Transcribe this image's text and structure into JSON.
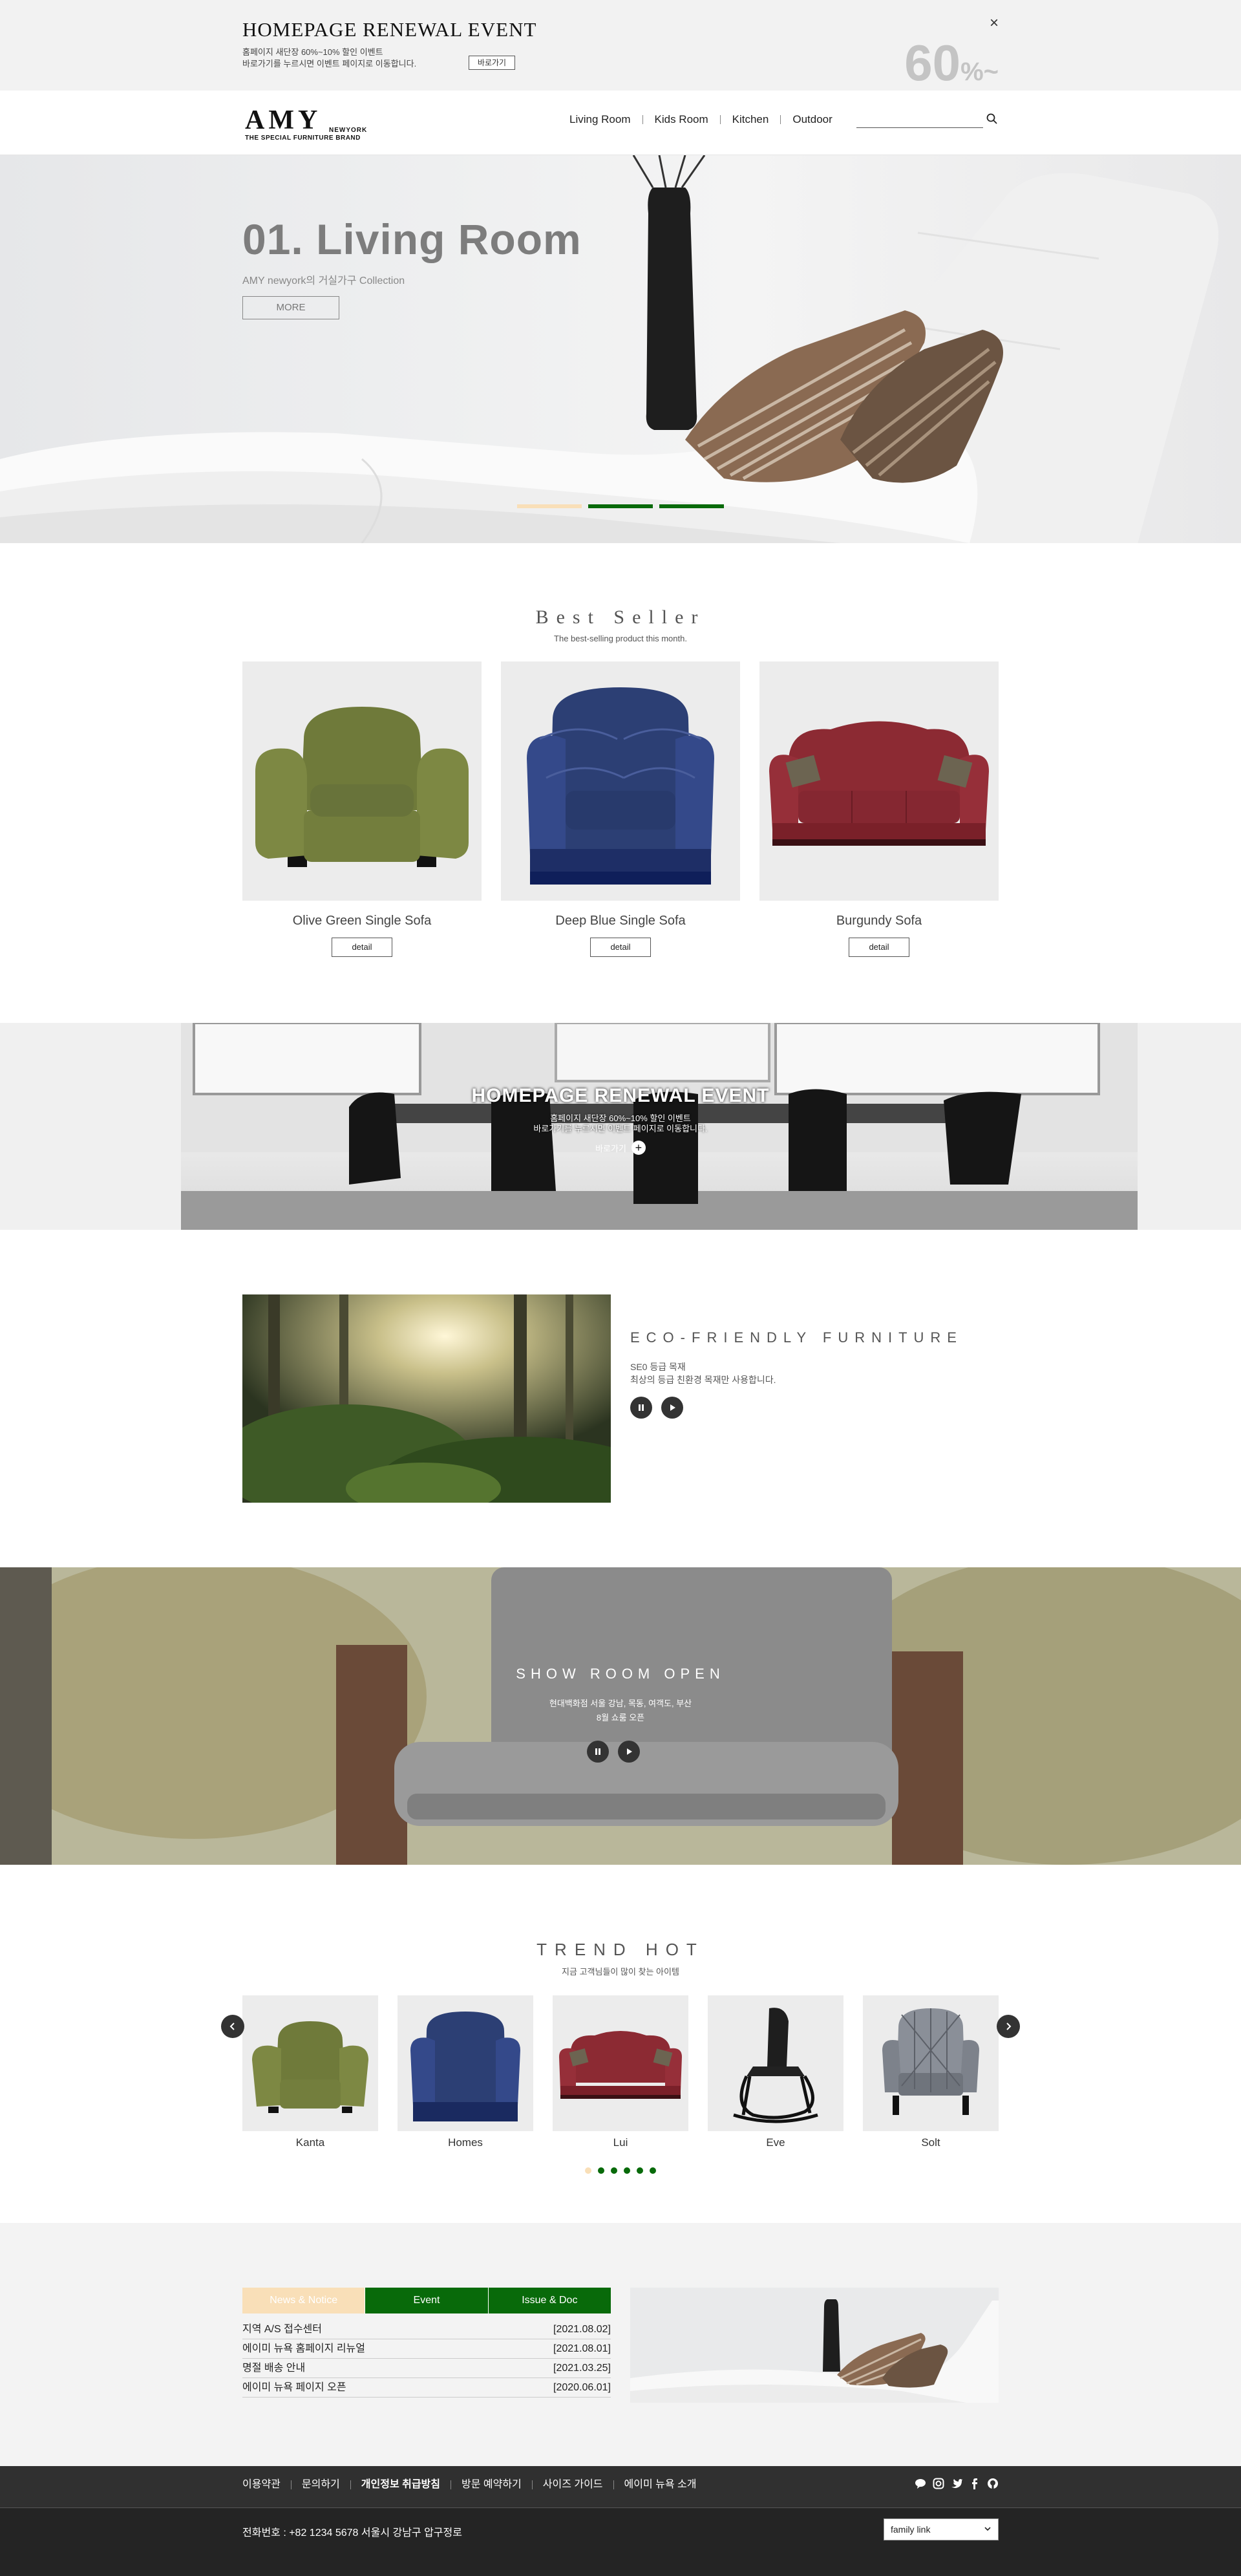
{
  "topbar": {
    "title": "HOMEPAGE RENEWAL EVENT",
    "line1": "홈페이지 새단장 60%~10% 할인 이벤트",
    "line2": "바로가기를 누르시면 이벤트 페이지로 이동합니다.",
    "button": "바로가기",
    "close": "×",
    "percent": "60",
    "percent_suffix": "%~"
  },
  "header": {
    "logo_main": "AMY",
    "logo_ny": "NEWYORK",
    "logo_sub": "THE SPECIAL FURNITURE BRAND",
    "nav": [
      "Living Room",
      "Kids Room",
      "Kitchen",
      "Outdoor"
    ],
    "search_placeholder": ""
  },
  "hero": {
    "title": "01. Living Room",
    "subtitle": "AMY newyork의 거실가구 Collection",
    "button": "MORE",
    "active_slide": 1,
    "slide_count": 3
  },
  "best": {
    "title": "Best Seller",
    "subtitle": "The best-selling product this month.",
    "items": [
      {
        "name": "Olive Green Single Sofa",
        "button": "detail"
      },
      {
        "name": "Deep Blue Single Sofa",
        "button": "detail"
      },
      {
        "name": "Burgundy Sofa",
        "button": "detail"
      }
    ]
  },
  "event": {
    "title": "HOMEPAGE RENEWAL EVENT",
    "line1": "홈페이지 새단장 60%~10% 할인 이벤트",
    "line2": "바로가기를 누르시면 이벤트 페이지로 이동합니다.",
    "more": "바로가기"
  },
  "eco": {
    "title": "ECO-FRIENDLY FURNITURE",
    "line1": "SE0 등급 목재",
    "line2": "최상의 등급 친환경 목재만 사용합니다."
  },
  "showroom": {
    "title": "SHOW ROOM OPEN",
    "line1": "현대백화점 서울 강남, 목동, 여객도, 부산",
    "line2": "8월 쇼룸 오픈"
  },
  "trend": {
    "title": "TREND HOT",
    "subtitle": "지금 고객님들이 많이 찾는 아이템",
    "items": [
      {
        "name": "Kanta"
      },
      {
        "name": "Homes"
      },
      {
        "name": "Lui"
      },
      {
        "name": "Eve"
      },
      {
        "name": "Solt"
      }
    ],
    "active_dot": 1,
    "dot_count": 6
  },
  "notice": {
    "tabs": [
      "News & Notice",
      "Event",
      "Issue & Doc"
    ],
    "active_tab": 1,
    "rows": [
      {
        "title": "지역 A/S 접수센터",
        "date": "[2021.08.02]"
      },
      {
        "title": "에이미 뉴욕 홈페이지 리뉴얼",
        "date": "[2021.08.01]"
      },
      {
        "title": "명절 배송 안내",
        "date": "[2021.03.25]"
      },
      {
        "title": "에이미 뉴욕 페이지 오픈",
        "date": "[2020.06.01]"
      }
    ]
  },
  "footer": {
    "menu": [
      "이용약관",
      "문의하기",
      "개인정보 취급방침",
      "방문 예약하기",
      "사이즈 가이드",
      "에이미 뉴욕 소개"
    ],
    "sns": [
      "chat-icon",
      "instagram-icon",
      "twitter-icon",
      "facebook-icon",
      "github-icon"
    ],
    "address": "전화번호 : +82 1234 5678 서울시 강남구 압구정로",
    "family_link": "family link"
  },
  "colors": {
    "accent_green": "#086a0a",
    "accent_peach": "#f9dfb8",
    "footer_dark": "#303030"
  }
}
